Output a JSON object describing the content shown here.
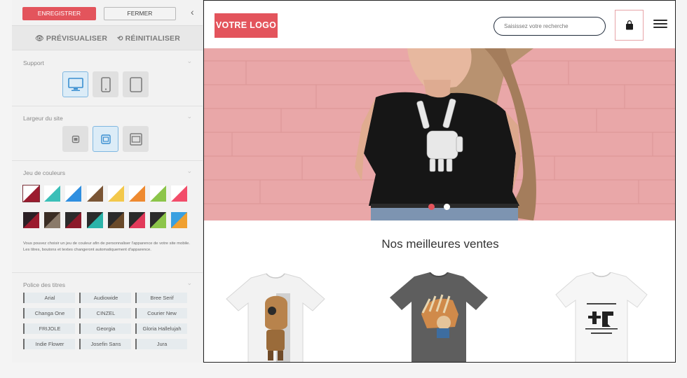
{
  "editor": {
    "save_label": "ENREGISTRER",
    "close_label": "FERMER",
    "preview_label": "PRÉVISUALISER",
    "reset_label": "RÉINITIALISER",
    "support": {
      "title": "Support",
      "devices": [
        "desktop",
        "mobile",
        "tablet"
      ],
      "selected": "desktop"
    },
    "width": {
      "title": "Largeur du site",
      "options": [
        "narrow",
        "medium",
        "wide"
      ],
      "selected": "medium"
    },
    "colors": {
      "title": "Jeu de couleurs",
      "note": "Vous pouvez choisir un jeu de couleur afin de personnaliser l'apparence de votre site mobile. Les titres, boutons et textes changeront automatiquement d'apparence.",
      "swatches": [
        {
          "a": "#9b1b2e",
          "b": "#ffffff"
        },
        {
          "a": "#3bbfb8",
          "b": "#ffffff"
        },
        {
          "a": "#2f8fe0",
          "b": "#ffffff"
        },
        {
          "a": "#7a5535",
          "b": "#ffffff"
        },
        {
          "a": "#f3c84b",
          "b": "#ffffff"
        },
        {
          "a": "#ee8a30",
          "b": "#ffffff"
        },
        {
          "a": "#8cc54a",
          "b": "#ffffff"
        },
        {
          "a": "#f24d6a",
          "b": "#ffffff"
        },
        {
          "a": "#9b1b2e",
          "b": "#2b1f24"
        },
        {
          "a": "#8a7a6a",
          "b": "#3a2d24"
        },
        {
          "a": "#8c1a2a",
          "b": "#2b2b2b"
        },
        {
          "a": "#2bb3a9",
          "b": "#2b2b2b"
        },
        {
          "a": "#6a4a2a",
          "b": "#2b2b2b"
        },
        {
          "a": "#e23a5a",
          "b": "#2b2b2b"
        },
        {
          "a": "#8cc54a",
          "b": "#2b2b2b"
        },
        {
          "a": "#f0a030",
          "b": "#3aa0e0"
        }
      ]
    },
    "fonts": {
      "title": "Police des titres",
      "items": [
        "Arial",
        "Audiowide",
        "Bree Serif",
        "Changa One",
        "CINZEL",
        "Courier New",
        "FRIJOLE",
        "Georgia",
        "Gloria Hallelujah",
        "Indie Flower",
        "Josefin Sans",
        "Jura"
      ]
    }
  },
  "site": {
    "logo": "VOTRE LOGO",
    "search_placeholder": "Saisissez votre recherche",
    "section_title": "Nos meilleures ventes",
    "colors": {
      "brand": "#e3545c",
      "hero": "#e9a7a7"
    },
    "products": [
      "tshirt-white-robot",
      "tshirt-grey-headdress",
      "tshirt-white-dino"
    ]
  }
}
